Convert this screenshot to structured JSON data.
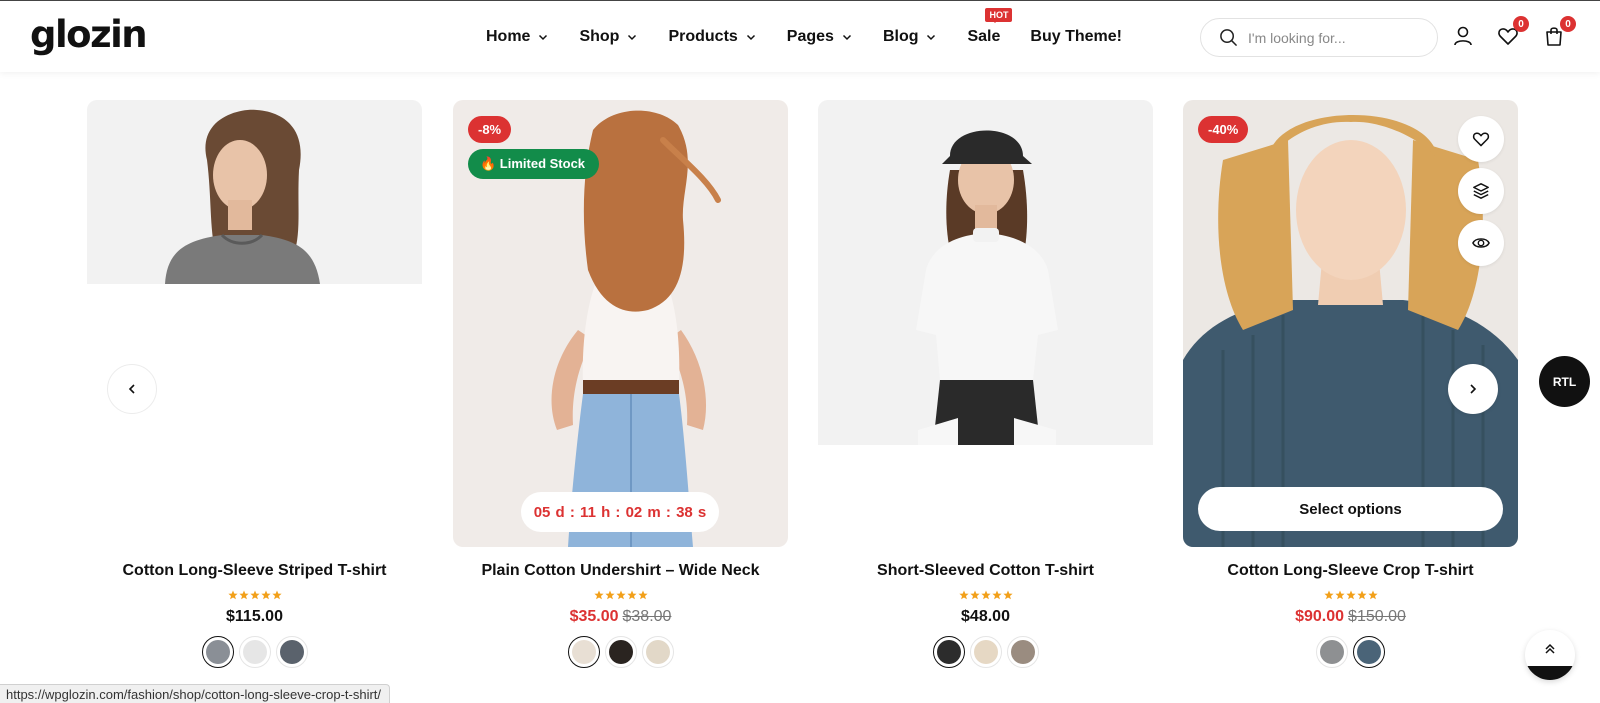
{
  "logo": "glozin",
  "nav": {
    "items": [
      {
        "label": "Home",
        "chevron": true
      },
      {
        "label": "Shop",
        "chevron": true
      },
      {
        "label": "Products",
        "chevron": true
      },
      {
        "label": "Pages",
        "chevron": true
      },
      {
        "label": "Blog",
        "chevron": true
      },
      {
        "label": "Sale",
        "chevron": false,
        "badge": "HOT"
      },
      {
        "label": "Buy Theme!",
        "chevron": false
      }
    ]
  },
  "search": {
    "placeholder": "I'm looking for..."
  },
  "header_icons": {
    "wishlist_count": "0",
    "cart_count": "0"
  },
  "products": [
    {
      "title": "Cotton Long-Sleeve Striped T-shirt",
      "price": "$115.00",
      "rating": 5,
      "swatches": [
        {
          "color": "#8a8f96",
          "active": true
        },
        {
          "color": "#e6e6e6",
          "active": false
        },
        {
          "color": "#5a626c",
          "active": false
        }
      ]
    },
    {
      "title": "Plain Cotton Undershirt – Wide Neck",
      "sale_badge": "-8%",
      "stock_badge": "🔥 Limited Stock",
      "countdown": "05 d : 11 h : 02 m : 38 s",
      "sale_price": "$35.00",
      "old_price": "$38.00",
      "rating": 5,
      "swatches": [
        {
          "color": "#e8dfd4",
          "active": true
        },
        {
          "color": "#2a2420",
          "active": false
        },
        {
          "color": "#e2d8c8",
          "active": false
        }
      ]
    },
    {
      "title": "Short-Sleeved Cotton T-shirt",
      "price": "$48.00",
      "rating": 5,
      "swatches": [
        {
          "color": "#2c2c2c",
          "active": true
        },
        {
          "color": "#e6d8c4",
          "active": false
        },
        {
          "color": "#9a8c80",
          "active": false
        }
      ]
    },
    {
      "title": "Cotton Long-Sleeve Crop T-shirt",
      "sale_badge": "-40%",
      "select_label": "Select options",
      "sale_price": "$90.00",
      "old_price": "$150.00",
      "rating": 5,
      "swatches": [
        {
          "color": "#8e9092",
          "active": false
        },
        {
          "color": "#4a6478",
          "active": true
        }
      ]
    }
  ],
  "rtl_label": "RTL",
  "status_url": "https://wpglozin.com/fashion/shop/cotton-long-sleeve-crop-t-shirt/",
  "colors": {
    "accent_red": "#dc3232",
    "stock_green": "#128c4a",
    "star": "#f2a01a",
    "text": "#111111"
  }
}
